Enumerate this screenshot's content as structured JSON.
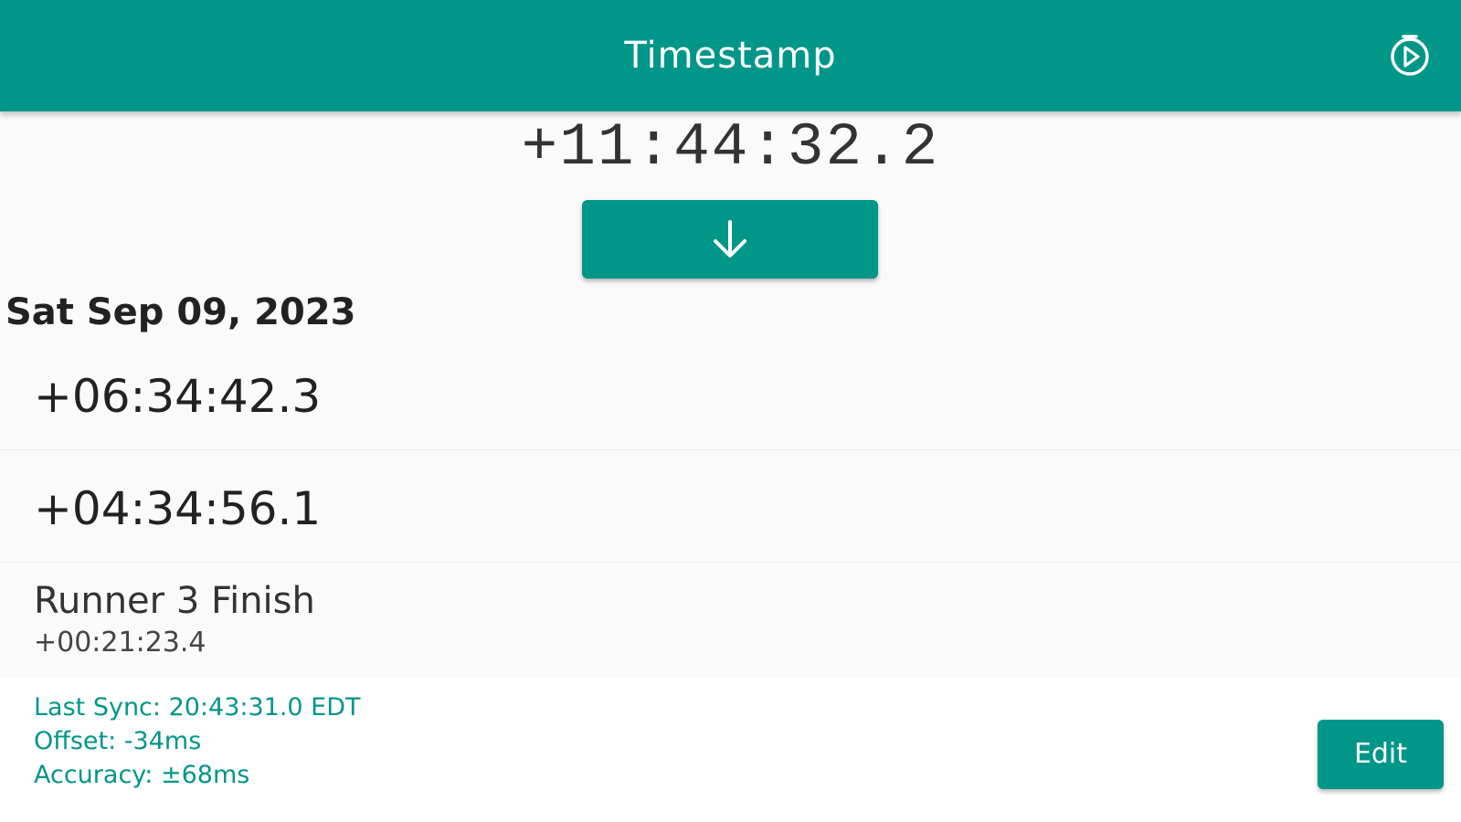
{
  "app_bar": {
    "title": "Timestamp",
    "settings_icon": "timer-play-icon",
    "background": "#009688"
  },
  "clock": {
    "current_time": "+11:44:32.2"
  },
  "stamp_button": {
    "icon": "arrow-down-icon"
  },
  "log": {
    "date_header": "Sat Sep 09, 2023",
    "entries": [
      {
        "time": "+06:34:42.3"
      },
      {
        "time": "+04:34:56.1"
      },
      {
        "label": "Runner 3 Finish",
        "time": "+00:21:23.4"
      }
    ]
  },
  "footer": {
    "last_sync": "Last Sync: 20:43:31.0 EDT",
    "offset": "Offset: -34ms",
    "accuracy": "Accuracy: ±68ms",
    "edit_label": "Edit",
    "accent": "#009688"
  }
}
